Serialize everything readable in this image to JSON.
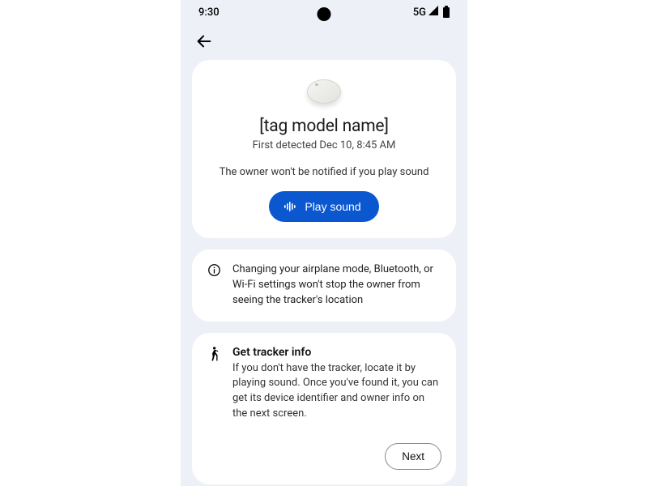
{
  "status": {
    "time": "9:30",
    "network": "5G"
  },
  "hero": {
    "title": "[tag model name]",
    "subtitle": "First detected Dec 10, 8:45 AM",
    "notice": "The owner won't be notified if you play sound",
    "play_label": "Play sound"
  },
  "info": {
    "text": "Changing your airplane mode, Bluetooth, or Wi-Fi settings won't stop the owner from seeing the tracker's location"
  },
  "tracker": {
    "title": "Get tracker info",
    "text": "If you don't have the tracker, locate it by playing sound. Once you've found it, you can get its device identifier and owner info on the next screen.",
    "next_label": "Next"
  }
}
